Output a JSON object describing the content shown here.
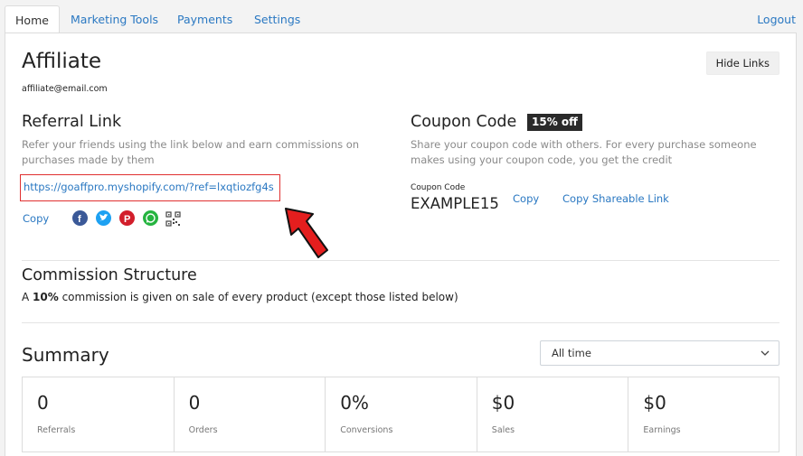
{
  "nav": {
    "tabs": [
      "Home",
      "Marketing Tools",
      "Payments",
      "Settings"
    ],
    "logout": "Logout"
  },
  "header": {
    "title": "Affiliate",
    "email": "affiliate@email.com",
    "hide_links": "Hide Links"
  },
  "referral": {
    "title": "Referral Link",
    "description": "Refer your friends using the link below and earn commissions on purchases made by them",
    "link": "https://goaffpro.myshopify.com/?ref=lxqtiozfg4s",
    "copy": "Copy",
    "social_icons": [
      "facebook-icon",
      "twitter-icon",
      "pinterest-icon",
      "whatsapp-icon",
      "qr-code-icon"
    ]
  },
  "coupon": {
    "title": "Coupon Code",
    "badge": "15% off",
    "description": "Share your coupon code with others. For every purchase someone makes using your coupon code, you get the credit",
    "code_label": "Coupon Code",
    "code": "EXAMPLE15",
    "copy": "Copy",
    "copy_share": "Copy Shareable Link"
  },
  "commission": {
    "title": "Commission Structure",
    "prefix": "A ",
    "rate": "10%",
    "suffix": " commission is given on sale of every product (except those listed below)"
  },
  "summary": {
    "title": "Summary",
    "period": "All time",
    "stats": [
      {
        "value": "0",
        "label": "Referrals"
      },
      {
        "value": "0",
        "label": "Orders"
      },
      {
        "value": "0%",
        "label": "Conversions"
      },
      {
        "value": "$0",
        "label": "Sales"
      },
      {
        "value": "$0",
        "label": "Earnings"
      }
    ]
  },
  "colors": {
    "link": "#2a78c2",
    "highlight_border": "#e03030",
    "badge_bg": "#2a2a2a",
    "arrow": "#e41e1e"
  }
}
